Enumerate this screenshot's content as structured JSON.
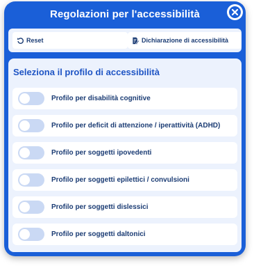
{
  "dialog": {
    "title": "Regolazioni per l'accessibilità",
    "close_icon": "close-circle-icon"
  },
  "toolbar": {
    "reset_label": "Reset",
    "reset_icon": "undo-icon",
    "declaration_label": "Dichiarazione di accessibilità",
    "declaration_icon": "edit-document-icon"
  },
  "profiles": {
    "heading": "Seleziona il profilo di accessibilità",
    "items": [
      {
        "label": "Profilo per disabilità cognitive",
        "enabled": false
      },
      {
        "label": "Profilo per deficit di attenzione / iperattività (ADHD)",
        "enabled": false
      },
      {
        "label": "Profilo per soggetti ipovedenti",
        "enabled": false
      },
      {
        "label": "Profilo per soggetti epilettici / convulsioni",
        "enabled": false
      },
      {
        "label": "Profilo per soggetti dislessici",
        "enabled": false
      },
      {
        "label": "Profilo per soggetti daltonici",
        "enabled": false
      }
    ]
  },
  "colors": {
    "panel_background": "#1a5fd8",
    "card_background": "#ecf2fd",
    "heading_text": "#1f55c4",
    "label_text": "#1b3c74",
    "toggle_off": "#cad9f4"
  }
}
